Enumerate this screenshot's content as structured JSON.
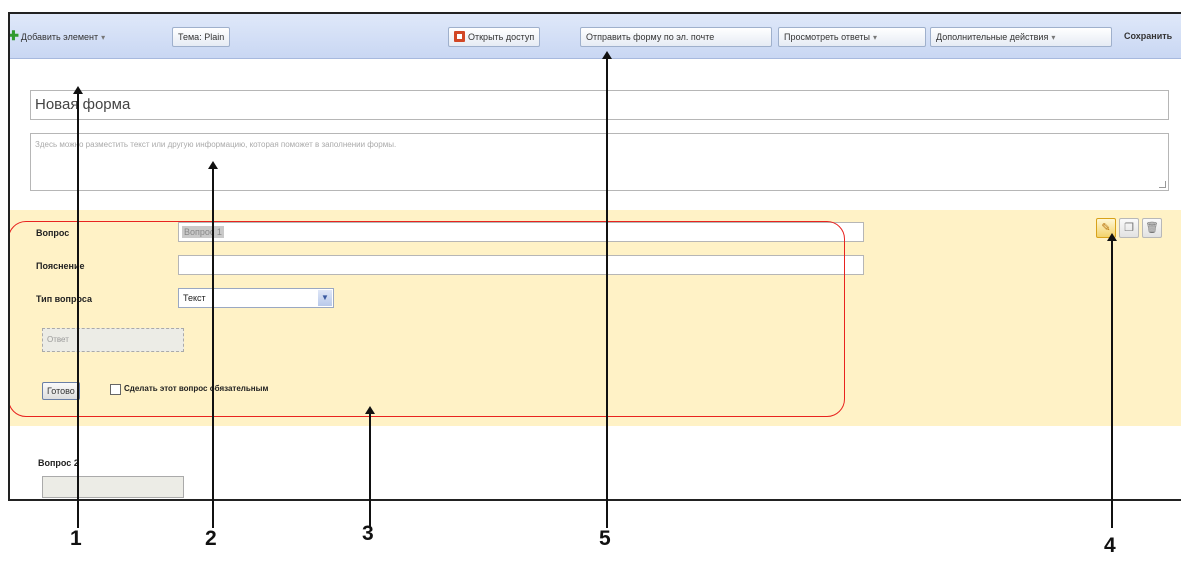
{
  "toolbar": {
    "add_item": "Добавить элемент",
    "theme": "Тема: Plain",
    "share": "Открыть доступ",
    "email_form": "Отправить форму по эл. почте",
    "view_responses": "Просмотреть ответы",
    "more_actions": "Дополнительные действия",
    "save": "Сохранить"
  },
  "form": {
    "title": "Новая форма",
    "description_placeholder": "Здесь можно разместить текст или другую информацию, которая поможет в заполнении формы."
  },
  "question_editor": {
    "question_label": "Вопрос",
    "question_value": "Вопрос 1",
    "help_label": "Пояснение",
    "help_value": "",
    "type_label": "Тип вопроса",
    "type_value": "Текст",
    "answer_placeholder": "Ответ",
    "done_label": "Готово",
    "required_label": "Сделать этот вопрос обязательным",
    "required_checked": false
  },
  "icons": {
    "edit": "pencil-icon",
    "duplicate": "duplicate-icon",
    "delete": "trash-icon"
  },
  "question2": {
    "label": "Вопрос 2"
  },
  "callouts": [
    "1",
    "2",
    "3",
    "4",
    "5"
  ],
  "colors": {
    "toolbar_bg": "#c9d7f3",
    "panel_bg": "#fff2c6",
    "highlight_ring": "#e8231f"
  }
}
